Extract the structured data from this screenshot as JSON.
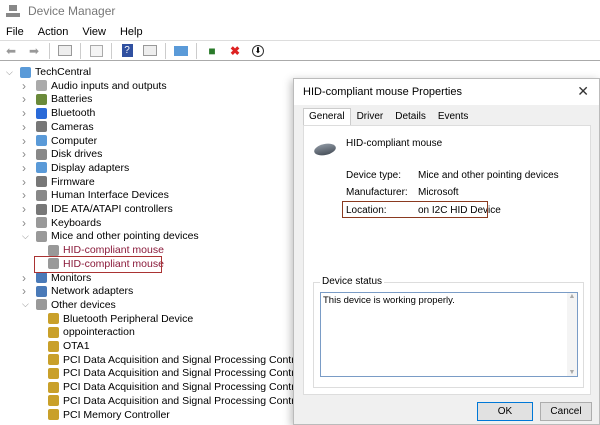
{
  "window": {
    "title": "Device Manager"
  },
  "menu": [
    "File",
    "Action",
    "View",
    "Help"
  ],
  "toolbar": [
    "back-icon",
    "forward-icon",
    "properties-view-icon",
    "show-hidden-icon",
    "help-icon",
    "details-pane-icon",
    "scan-hardware-icon",
    "update-driver-icon",
    "uninstall-icon",
    "disable-device-icon"
  ],
  "tree": {
    "root": "TechCentral",
    "items": [
      {
        "label": "Audio inputs and outputs",
        "level": 1,
        "icon": "speaker-icon"
      },
      {
        "label": "Batteries",
        "level": 1,
        "icon": "battery-icon"
      },
      {
        "label": "Bluetooth",
        "level": 1,
        "icon": "bluetooth-icon"
      },
      {
        "label": "Cameras",
        "level": 1,
        "icon": "camera-icon"
      },
      {
        "label": "Computer",
        "level": 1,
        "icon": "computer-icon"
      },
      {
        "label": "Disk drives",
        "level": 1,
        "icon": "disk-icon"
      },
      {
        "label": "Display adapters",
        "level": 1,
        "icon": "display-icon"
      },
      {
        "label": "Firmware",
        "level": 1,
        "icon": "firmware-icon"
      },
      {
        "label": "Human Interface Devices",
        "level": 1,
        "icon": "hid-icon"
      },
      {
        "label": "IDE ATA/ATAPI controllers",
        "level": 1,
        "icon": "ide-icon"
      },
      {
        "label": "Keyboards",
        "level": 1,
        "icon": "keyboard-icon"
      },
      {
        "label": "Mice and other pointing devices",
        "level": 1,
        "icon": "mouse-icon",
        "expanded": true
      },
      {
        "label": "HID-compliant mouse",
        "level": 2,
        "icon": "mouse-icon"
      },
      {
        "label": "HID-compliant mouse",
        "level": 2,
        "icon": "mouse-icon",
        "highlighted": true
      },
      {
        "label": "Monitors",
        "level": 1,
        "icon": "monitor-icon"
      },
      {
        "label": "Network adapters",
        "level": 1,
        "icon": "network-icon"
      },
      {
        "label": "Other devices",
        "level": 1,
        "icon": "unknown-device-icon",
        "expanded": true
      },
      {
        "label": "Bluetooth Peripheral Device",
        "level": 2,
        "icon": "warning-device-icon"
      },
      {
        "label": "oppointeraction",
        "level": 2,
        "icon": "warning-device-icon"
      },
      {
        "label": "OTA1",
        "level": 2,
        "icon": "warning-device-icon"
      },
      {
        "label": "PCI Data Acquisition and Signal Processing Controller",
        "level": 2,
        "icon": "warning-device-icon"
      },
      {
        "label": "PCI Data Acquisition and Signal Processing Controller",
        "level": 2,
        "icon": "warning-device-icon"
      },
      {
        "label": "PCI Data Acquisition and Signal Processing Controller",
        "level": 2,
        "icon": "warning-device-icon"
      },
      {
        "label": "PCI Data Acquisition and Signal Processing Controller",
        "level": 2,
        "icon": "warning-device-icon"
      },
      {
        "label": "PCI Memory Controller",
        "level": 2,
        "icon": "warning-device-icon"
      }
    ]
  },
  "dialog": {
    "title": "HID-compliant mouse Properties",
    "tabs": [
      "General",
      "Driver",
      "Details",
      "Events"
    ],
    "device_name": "HID-compliant mouse",
    "device_type_label": "Device type:",
    "device_type": "Mice and other pointing devices",
    "manufacturer_label": "Manufacturer:",
    "manufacturer": "Microsoft",
    "location_label": "Location:",
    "location": "on I2C HID Device",
    "status_title": "Device status",
    "status_text": "This device is working properly.",
    "ok": "OK",
    "cancel": "Cancel"
  }
}
